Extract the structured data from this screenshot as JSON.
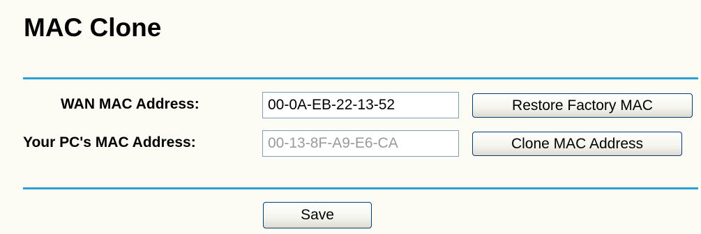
{
  "page": {
    "title": "MAC Clone"
  },
  "form": {
    "wan_mac": {
      "label": "WAN MAC Address:",
      "value": "00-0A-EB-22-13-52"
    },
    "pc_mac": {
      "label": "Your PC's MAC Address:",
      "value": "00-13-8F-A9-E6-CA"
    }
  },
  "buttons": {
    "restore_label": "Restore Factory MAC",
    "clone_label": "Clone MAC Address",
    "save_label": "Save"
  },
  "colors": {
    "background": "#fcfcf4",
    "divider": "#2a9fd6",
    "field_border": "#7f9db9",
    "disabled_text": "#9a9a9a"
  }
}
